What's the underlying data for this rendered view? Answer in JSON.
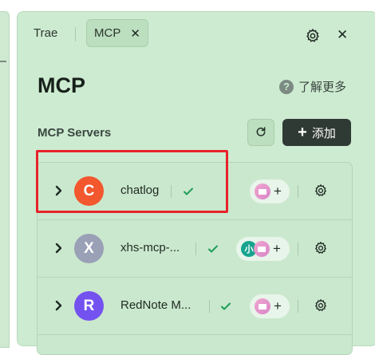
{
  "tabs": [
    {
      "label": "Trae"
    },
    {
      "label": "MCP",
      "close_glyph": "✕"
    }
  ],
  "header": {
    "close_glyph": "✕"
  },
  "title": "MCP",
  "learn_more": {
    "label": "了解更多",
    "icon": "?"
  },
  "servers": {
    "label": "MCP Servers",
    "add_label": "添加",
    "add_icon": "+",
    "items": [
      {
        "avatar_letter": "C",
        "avatar_color": "#f2572d",
        "name": "chatlog",
        "status": "connected",
        "tools": [
          "mail"
        ]
      },
      {
        "avatar_letter": "X",
        "avatar_color": "#9aa0b6",
        "name": "xhs-mcp-...",
        "status": "connected",
        "tools": [
          "xhs",
          "mail"
        ],
        "xhs_icon_text": "小"
      },
      {
        "avatar_letter": "R",
        "avatar_color": "#7452f0",
        "name": "RedNote M...",
        "status": "connected",
        "tools": [
          "mail"
        ]
      }
    ]
  },
  "tool_add_glyph": "+",
  "colors": {
    "panel": "#cdebd0",
    "highlight": "#e8222a",
    "check": "#1e9e5a",
    "add_button": "#303a35"
  }
}
